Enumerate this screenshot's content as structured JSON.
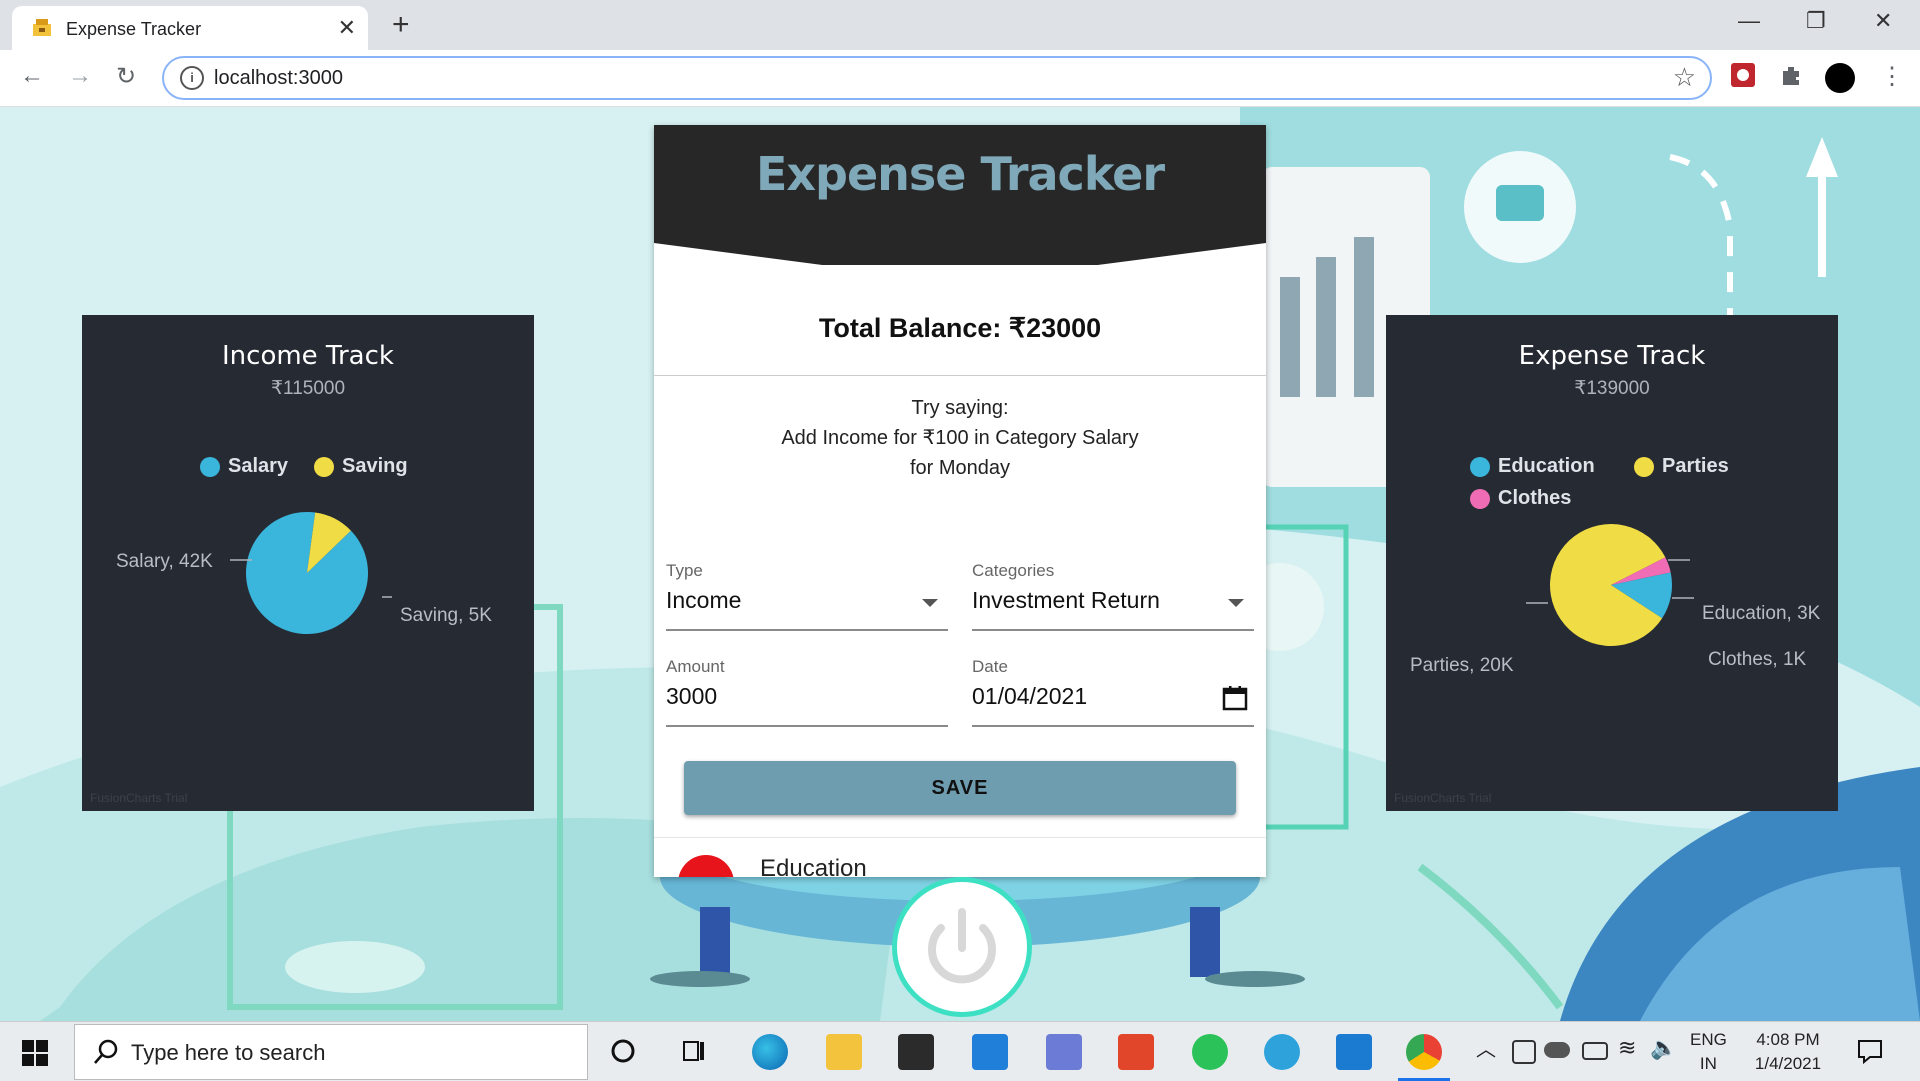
{
  "browser": {
    "tab_title": "Expense Tracker",
    "url": "localhost:3000"
  },
  "app": {
    "title": "Expense Tracker",
    "balance": "Total Balance: ₹23000",
    "try_line1": "Try saying:",
    "try_line2": "Add Income for ₹100 in Category Salary",
    "try_line3": "for Monday",
    "form": {
      "type_label": "Type",
      "type_value": "Income",
      "categories_label": "Categories",
      "categories_value": "Investment Return",
      "amount_label": "Amount",
      "amount_value": "3000",
      "date_label": "Date",
      "date_value": "01/04/2021",
      "save_label": "SAVE"
    },
    "list_first_item": "Education"
  },
  "income_chart": {
    "title": "Income Track",
    "subtitle": "₹115000",
    "trial": "FusionCharts Trial",
    "salary_label": "Salary, 42K",
    "saving_label": "Saving, 5K"
  },
  "expense_chart": {
    "title": "Expense Track",
    "subtitle": "₹139000",
    "trial": "FusionCharts Trial",
    "education_label": "Education, 3K",
    "clothes_label": "Clothes, 1K",
    "parties_label": "Parties, 20K"
  },
  "chart_data": [
    {
      "type": "pie",
      "title": "Income Track",
      "subtitle": "₹115000",
      "categories": [
        "Salary",
        "Saving"
      ],
      "values": [
        42000,
        5000
      ],
      "colors": [
        "#3ab5dc",
        "#f0dc44"
      ],
      "legend": "top"
    },
    {
      "type": "pie",
      "title": "Expense Track",
      "subtitle": "₹139000",
      "categories": [
        "Education",
        "Parties",
        "Clothes"
      ],
      "values": [
        3000,
        20000,
        1000
      ],
      "colors": [
        "#3ab5dc",
        "#f0dc44",
        "#f06db5"
      ],
      "legend": "top"
    }
  ],
  "taskbar": {
    "search_placeholder": "Type here to search",
    "lang_top": "ENG",
    "lang_bottom": "IN",
    "time": "4:08 PM",
    "date": "1/4/2021"
  }
}
